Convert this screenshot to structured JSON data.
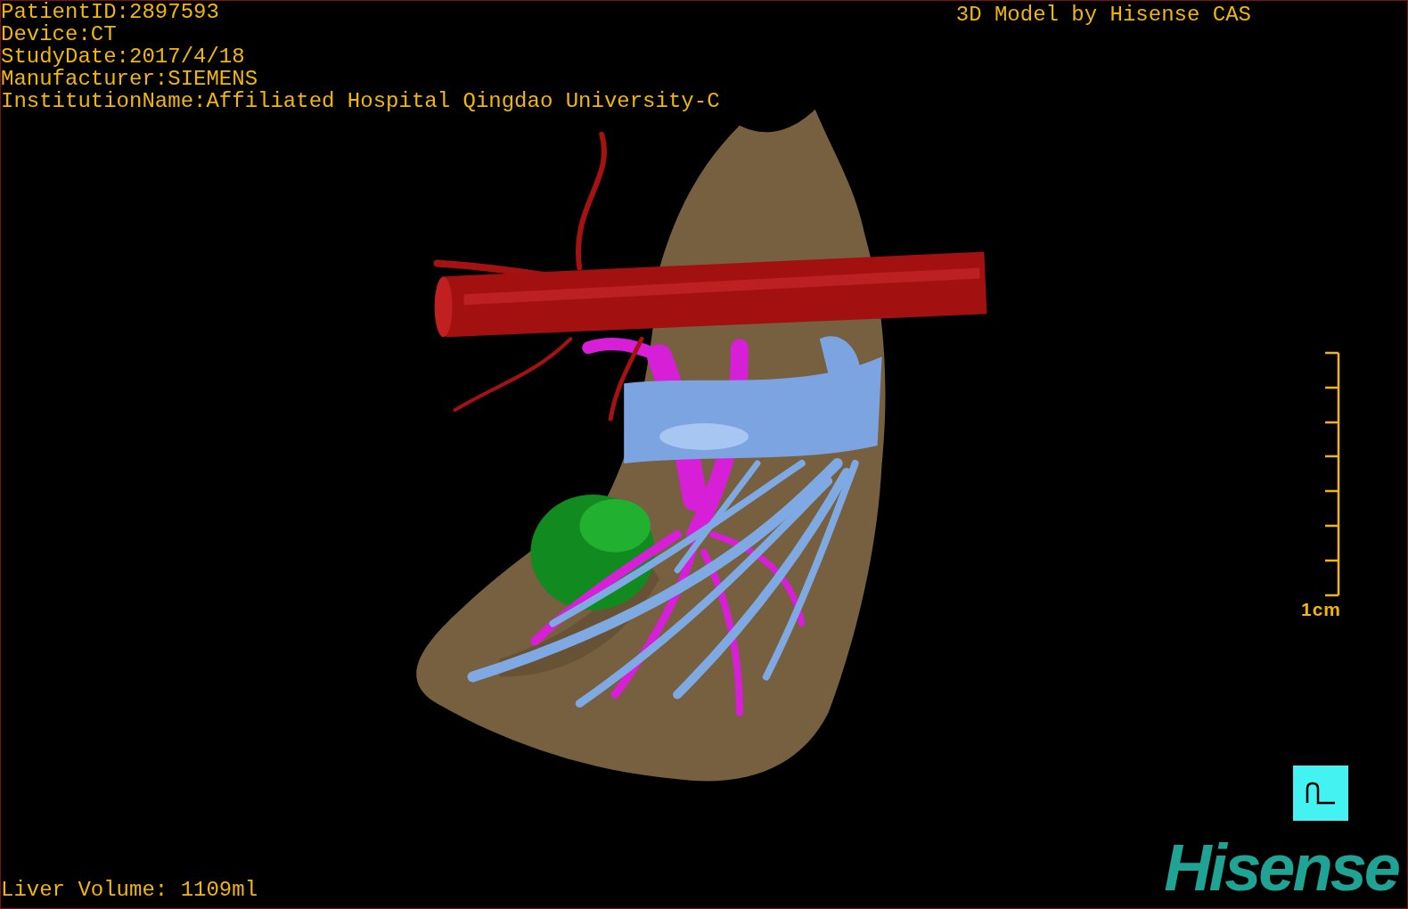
{
  "info_lines": [
    "PatientID:2897593",
    "Device:CT",
    "StudyDate:2017/4/18",
    "Manufacturer:SIEMENS",
    "InstitutionName:Affiliated Hospital Qingdao University-C"
  ],
  "title": "3D Model by Hisense CAS",
  "scale_label": "1cm",
  "liver_volume": "Liver Volume: 1109ml",
  "logo": "Hisense"
}
